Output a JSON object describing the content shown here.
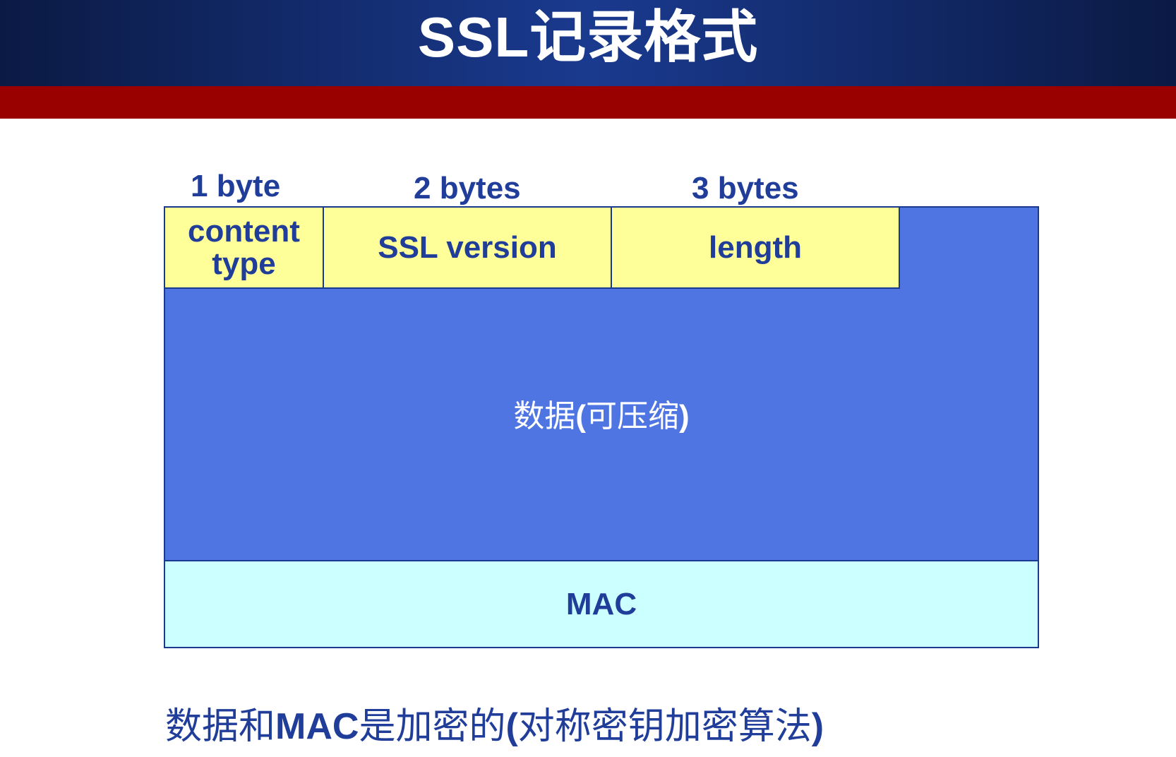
{
  "slide": {
    "title": "SSL记录格式"
  },
  "diagram": {
    "byte_labels": [
      "1 byte",
      "2 bytes",
      "3 bytes"
    ],
    "header_fields": {
      "content_type_line1": "content",
      "content_type_line2": "type",
      "ssl_version": "SSL version",
      "length": "length"
    },
    "data_block": {
      "label_prefix": "数据",
      "label_open": "(",
      "label_middle": "可压缩",
      "label_close": ")"
    },
    "mac_block": {
      "label": "MAC"
    }
  },
  "footnote": {
    "part1": "数据和",
    "part2": "MAC",
    "part3": "是加密的",
    "part4": "(",
    "part5": "对称密钥加密算法",
    "part6": ")"
  },
  "colors": {
    "header_gradient_mid": "#1a3a8f",
    "header_gradient_edge": "#0b1a44",
    "red_band": "#990000",
    "header_field_fill": "#ffff99",
    "data_fill": "#4f75e3",
    "mac_fill": "#ccffff",
    "text_blue": "#1f3d99",
    "border": "#1a3a8f"
  }
}
